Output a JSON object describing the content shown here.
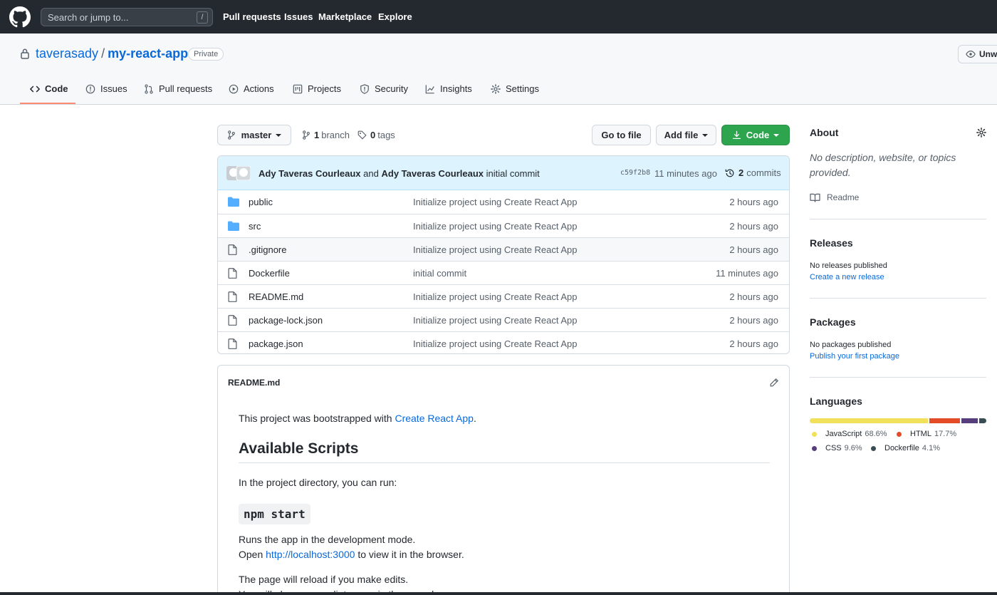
{
  "topbar": {
    "search_placeholder": "Search or jump to...",
    "search_shortcut": "/",
    "nav": [
      "Pull requests",
      "Issues",
      "Marketplace",
      "Explore"
    ]
  },
  "repo": {
    "owner": "taverasady",
    "separator": "/",
    "name": "my-react-app",
    "visibility": "Private",
    "watch_label": "Unwa"
  },
  "tabs": [
    {
      "label": "Code",
      "icon": "code-icon",
      "active": true
    },
    {
      "label": "Issues",
      "icon": "issue-icon"
    },
    {
      "label": "Pull requests",
      "icon": "pull-request-icon"
    },
    {
      "label": "Actions",
      "icon": "play-icon"
    },
    {
      "label": "Projects",
      "icon": "project-icon"
    },
    {
      "label": "Security",
      "icon": "shield-icon"
    },
    {
      "label": "Insights",
      "icon": "graph-icon"
    },
    {
      "label": "Settings",
      "icon": "gear-icon"
    }
  ],
  "toolbar": {
    "branch": "master",
    "branch_count": "1",
    "branch_label": "branch",
    "tag_count": "0",
    "tag_label": "tags",
    "go_to_file": "Go to file",
    "add_file": "Add file",
    "code": "Code"
  },
  "commit": {
    "author1": "Ady Taveras Courleaux",
    "and": "and",
    "author2": "Ady Taveras Courleaux",
    "message": "initial commit",
    "sha": "c59f2b8",
    "time": "11 minutes ago",
    "count": "2",
    "count_label": "commits"
  },
  "files": [
    {
      "name": "public",
      "type": "folder",
      "message": "Initialize project using Create React App",
      "age": "2 hours ago"
    },
    {
      "name": "src",
      "type": "folder",
      "message": "Initialize project using Create React App",
      "age": "2 hours ago"
    },
    {
      "name": ".gitignore",
      "type": "file",
      "message": "Initialize project using Create React App",
      "age": "2 hours ago"
    },
    {
      "name": "Dockerfile",
      "type": "file",
      "message": "initial commit",
      "age": "11 minutes ago"
    },
    {
      "name": "README.md",
      "type": "file",
      "message": "Initialize project using Create React App",
      "age": "2 hours ago"
    },
    {
      "name": "package-lock.json",
      "type": "file",
      "message": "Initialize project using Create React App",
      "age": "2 hours ago"
    },
    {
      "name": "package.json",
      "type": "file",
      "message": "Initialize project using Create React App",
      "age": "2 hours ago"
    }
  ],
  "readme": {
    "title": "README.md",
    "p1_before": "This project was bootstrapped with ",
    "p1_link": "Create React App",
    "p1_after": ".",
    "h2": "Available Scripts",
    "p2": "In the project directory, you can run:",
    "code": "npm start",
    "p3": "Runs the app in the development mode.",
    "p4_before": "Open ",
    "p4_link": "http://localhost:3000",
    "p4_after": " to view it in the browser.",
    "p5": "The page will reload if you make edits.",
    "p6": "You will also see any lint errors in the console."
  },
  "sidebar": {
    "about_title": "About",
    "about_desc": "No description, website, or topics provided.",
    "readme_label": "Readme",
    "releases_title": "Releases",
    "releases_text": "No releases published",
    "releases_link": "Create a new release",
    "packages_title": "Packages",
    "packages_text": "No packages published",
    "packages_link": "Publish your first package",
    "languages_title": "Languages",
    "languages": [
      {
        "name": "JavaScript",
        "pct": "68.6%",
        "value": 68.6,
        "color": "#f1e05a"
      },
      {
        "name": "HTML",
        "pct": "17.7%",
        "value": 17.7,
        "color": "#e34c26"
      },
      {
        "name": "CSS",
        "pct": "9.6%",
        "value": 9.6,
        "color": "#563d7c"
      },
      {
        "name": "Dockerfile",
        "pct": "4.1%",
        "value": 4.1,
        "color": "#384d54"
      }
    ]
  }
}
